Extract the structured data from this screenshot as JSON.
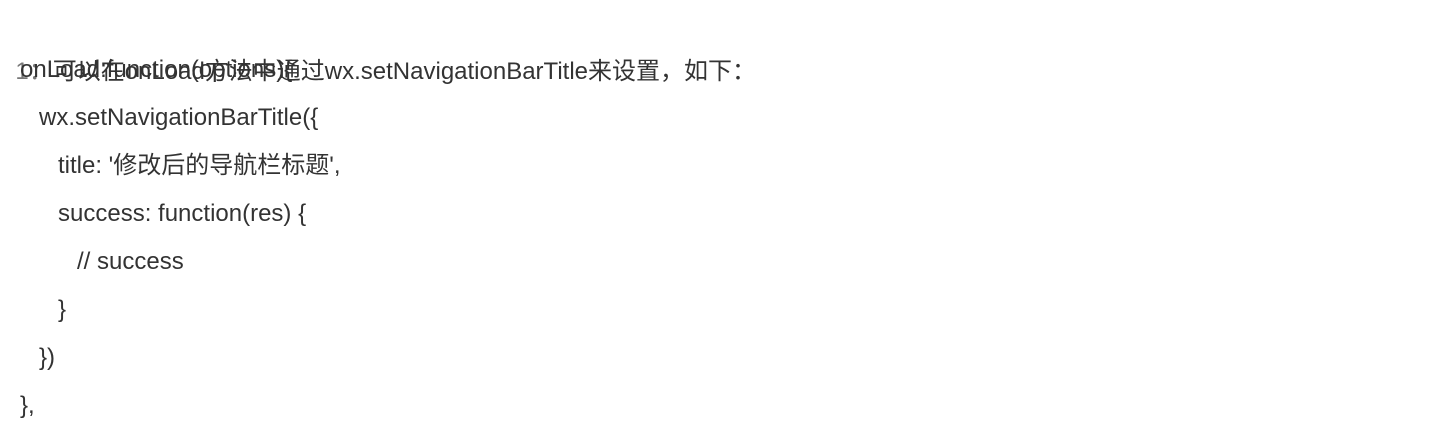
{
  "intro": {
    "number": "1：",
    "text": "可以在onLoad方法中通过wx.setNavigationBarTitle来设置，如下："
  },
  "code_lines": [
    "onLoad:function(options){",
    "wx.setNavigationBarTitle({",
    "title: '修改后的导航栏标题',",
    "success: function(res) {",
    "// success",
    "}",
    "})",
    "},"
  ]
}
